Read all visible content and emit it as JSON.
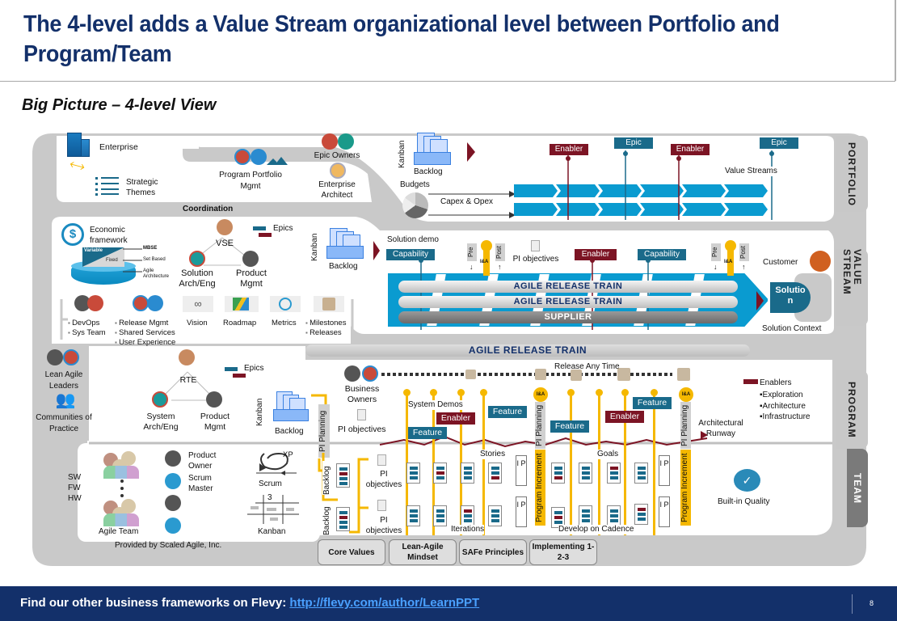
{
  "header": {
    "title": "The 4-level adds a Value Stream organizational level between Portfolio and Program/Team",
    "subtitle": "Big Picture – 4-level View"
  },
  "colors": {
    "title": "#13306a",
    "teal": "#1a6a8a",
    "maroon": "#7c1424",
    "value_stream_blue": "#0a9bd0",
    "yellow": "#f5b800",
    "tab_gray": "#c8c8c8",
    "team_tab": "#7a7a7a",
    "footer_bg": "#13306a"
  },
  "level_tabs": [
    "PORTFOLIO",
    "VALUE STREAM",
    "PROGRAM",
    "TEAM"
  ],
  "portfolio": {
    "enterprise": "Enterprise",
    "strategic_themes": "Strategic Themes",
    "program_portfolio_mgmt": "Program Portfolio Mgmt",
    "epic_owners": "Epic Owners",
    "enterprise_architect": "Enterprise Architect",
    "kanban": "Kanban",
    "backlog": "Backlog",
    "budgets": "Budgets",
    "capex_opex": "Capex & Opex",
    "value_streams": "Value Streams",
    "backlog_items": [
      {
        "label": "Enabler",
        "type": "maroon"
      },
      {
        "label": "Epic",
        "type": "teal"
      },
      {
        "label": "Enabler",
        "type": "maroon"
      },
      {
        "label": "Epic",
        "type": "teal"
      }
    ],
    "coordination": "Coordination"
  },
  "value_stream": {
    "economic_framework": "Economic framework",
    "variable": "Variable",
    "fixed": "Fixed",
    "econ_labels": [
      "MBSE",
      "Set Based",
      "Agile Architecture"
    ],
    "vse": "VSE",
    "solution_arch": "Solution Arch/Eng",
    "product_mgmt": "Product Mgmt",
    "epics": "Epics",
    "kanban": "Kanban",
    "backlog": "Backlog",
    "solution_demo": "Solution demo",
    "pi_objectives": "PI objectives",
    "pre": "Pre",
    "post": "Post",
    "ia": "I&A",
    "items": [
      {
        "label": "Capability",
        "type": "teal"
      },
      {
        "label": "Enabler",
        "type": "maroon"
      },
      {
        "label": "Capability",
        "type": "teal"
      }
    ],
    "trains": [
      "AGILE RELEASE TRAIN",
      "AGILE RELEASE TRAIN",
      "SUPPLIER"
    ],
    "customer": "Customer",
    "solution": "Solution",
    "solution_context": "Solution Context",
    "shared_roles": [
      {
        "items": [
          "DevOps",
          "Sys Team"
        ]
      },
      {
        "items": [
          "Release Mgmt",
          "Shared Services",
          "User Experience"
        ]
      },
      {
        "label": "Vision"
      },
      {
        "label": "Roadmap"
      },
      {
        "label": "Metrics"
      },
      {
        "items": [
          "Milestones",
          "Releases"
        ]
      }
    ]
  },
  "sidebar_left": {
    "lean_agile_leaders": "Lean Agile Leaders",
    "communities": "Communities of Practice"
  },
  "program": {
    "art_banner": "AGILE RELEASE TRAIN",
    "rte": "RTE",
    "system_arch": "System Arch/Eng",
    "product_mgmt": "Product Mgmt",
    "epics": "Epics",
    "kanban": "Kanban",
    "backlog": "Backlog",
    "pi_planning": "PI Planning",
    "business_owners": "Business Owners",
    "pi_objectives": "PI objectives",
    "release_any_time": "Release Any Time",
    "system_demos": "System Demos",
    "items": [
      {
        "label": "Feature",
        "type": "teal"
      },
      {
        "label": "Enabler",
        "type": "maroon"
      },
      {
        "label": "Feature",
        "type": "teal"
      },
      {
        "label": "Feature",
        "type": "teal"
      },
      {
        "label": "Enabler",
        "type": "maroon"
      },
      {
        "label": "Feature",
        "type": "teal"
      }
    ],
    "architectural_runway": "Architectural Runway",
    "enablers_legend": "Enablers",
    "enabler_types": [
      "Exploration",
      "Architecture",
      "Infrastructure"
    ]
  },
  "team": {
    "sw_fw_hw": [
      "SW",
      "FW",
      "HW"
    ],
    "agile_team": "Agile Team",
    "product_owner": "Product Owner",
    "scrum_master": "Scrum Master",
    "xp": "XP",
    "scrum": "Scrum",
    "kanban": "Kanban",
    "kanban_wip": "3",
    "backlog": "Backlog",
    "pi_objectives": "PI objectives",
    "stories": "Stories",
    "goals": "Goals",
    "iterations": "Iterations",
    "develop_on_cadence": "Develop on Cadence",
    "ip": "I P",
    "program_increment": "Program Increment",
    "built_in_quality": "Built-in Quality",
    "provided_by": "Provided by Scaled Agile, Inc."
  },
  "foundation_buttons": [
    "Core Values",
    "Lean-Agile Mindset",
    "SAFe Principles",
    "Implementing 1-2-3"
  ],
  "footer": {
    "text": "Find our other business frameworks on Flevy: ",
    "link": "http://flevy.com/author/LearnPPT",
    "page": "8"
  }
}
